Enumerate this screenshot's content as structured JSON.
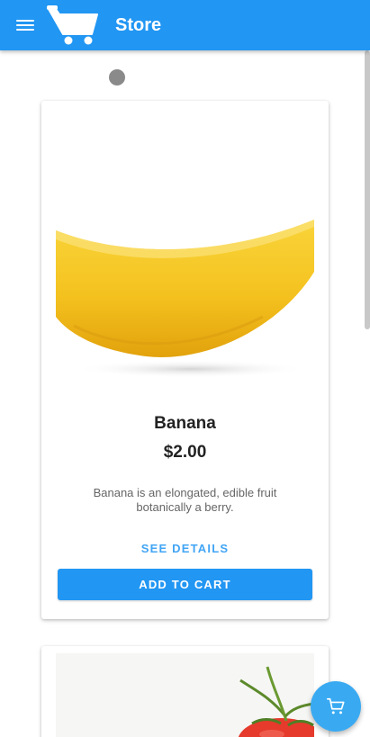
{
  "header": {
    "title": "Store",
    "menu_icon": "menu-icon",
    "logo_icon": "shopping-cart-icon"
  },
  "products": [
    {
      "name": "Banana",
      "price": "$2.00",
      "description": "Banana is an elongated, edible fruit botanically a berry.",
      "details_label": "SEE DETAILS",
      "add_label": "ADD TO CART",
      "image": "banana"
    },
    {
      "image": "tomato"
    }
  ],
  "fab": {
    "icon": "shopping-cart-icon"
  },
  "colors": {
    "primary": "#2196f3",
    "link": "#42a5f5",
    "fab": "#39aaf2"
  }
}
